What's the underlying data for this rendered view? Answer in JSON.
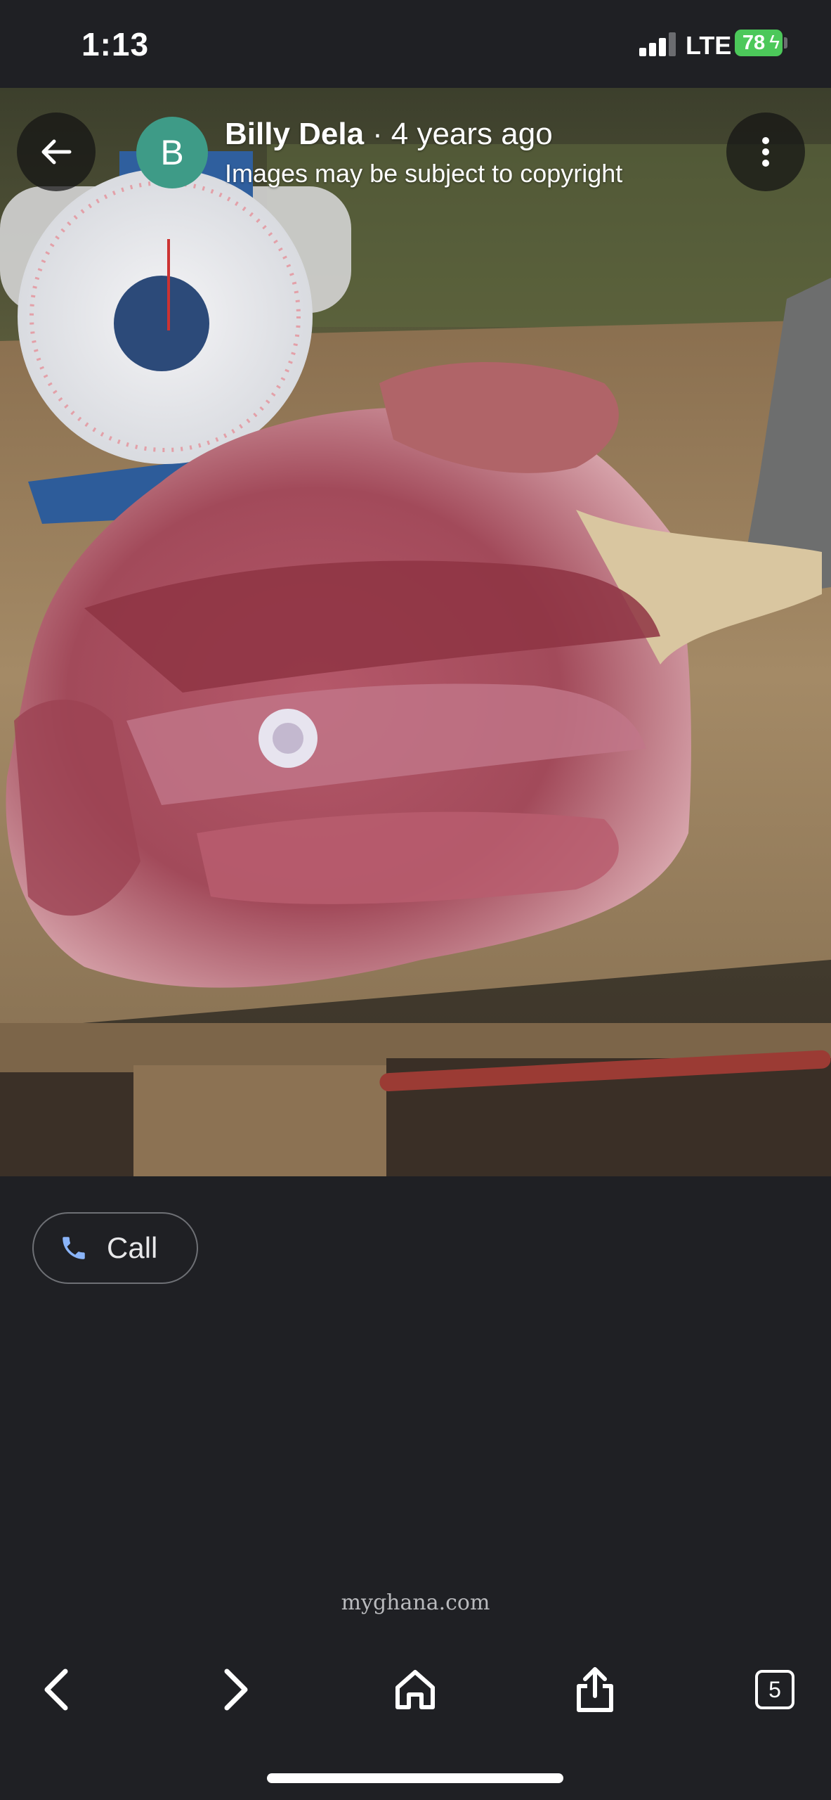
{
  "status_bar": {
    "time": "1:13",
    "network": "LTE",
    "battery_percent": "78",
    "battery_color": "#4cc85a"
  },
  "viewer": {
    "author_initial": "B",
    "author_name": "Billy Dela",
    "separator": "·",
    "posted": "4 years ago",
    "copyright_notice": "Images may be subject to copyright",
    "avatar_color": "#3e9b87",
    "back_icon": "arrow-left-icon",
    "more_icon": "more-vertical-icon"
  },
  "actions": {
    "call_label": "Call",
    "call_icon": "phone-icon",
    "call_icon_color": "#8ab4f8"
  },
  "source": {
    "site": "myghana.com"
  },
  "toolbar": {
    "tabs_count": "5",
    "icons": [
      "chevron-left-icon",
      "chevron-right-icon",
      "home-icon",
      "share-icon",
      "tabs-icon"
    ]
  }
}
